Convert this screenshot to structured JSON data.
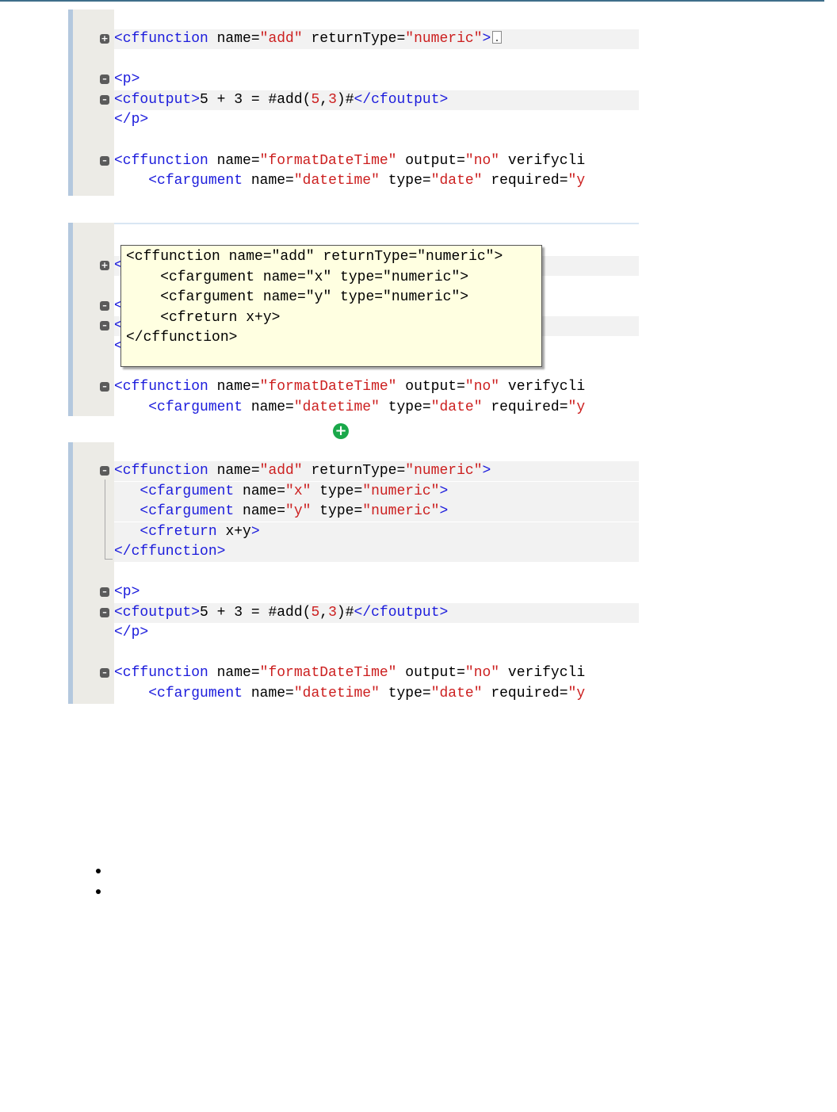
{
  "panel1": {
    "lines": [
      {
        "fold": "+",
        "parts": [
          [
            "t",
            "<cffunction "
          ],
          [
            "p",
            "name="
          ],
          [
            "s",
            "\"add\""
          ],
          [
            "p",
            " returnType="
          ],
          [
            "s",
            "\"numeric\""
          ],
          [
            "t",
            ">"
          ]
        ],
        "box": true
      },
      {
        "fold": "",
        "parts": []
      },
      {
        "fold": "-",
        "parts": [
          [
            "t",
            "<p>"
          ]
        ]
      },
      {
        "fold": "-",
        "parts": [
          [
            "t",
            "<cfoutput>"
          ],
          [
            "p",
            "5 + 3 = #add("
          ],
          [
            "n",
            "5"
          ],
          [
            "p",
            ","
          ],
          [
            "n",
            "3"
          ],
          [
            "p",
            ")#"
          ],
          [
            "t",
            "</cfoutput>"
          ]
        ]
      },
      {
        "fold": "",
        "parts": [
          [
            "t",
            "</p>"
          ]
        ]
      },
      {
        "fold": "",
        "parts": []
      },
      {
        "fold": "-",
        "parts": [
          [
            "t",
            "<cffunction "
          ],
          [
            "p",
            "name="
          ],
          [
            "s",
            "\"formatDateTime\""
          ],
          [
            "p",
            " output="
          ],
          [
            "s",
            "\"no\""
          ],
          [
            "p",
            " verifycli"
          ]
        ]
      },
      {
        "fold": "",
        "parts": [
          [
            "p",
            "    "
          ],
          [
            "t",
            "<cfargument "
          ],
          [
            "p",
            "name="
          ],
          [
            "s",
            "\"datetime\""
          ],
          [
            "p",
            " type="
          ],
          [
            "s",
            "\"date\""
          ],
          [
            "p",
            " required="
          ],
          [
            "s",
            "\"y"
          ]
        ]
      }
    ]
  },
  "panel2": {
    "lines": [
      {
        "fold": "",
        "parts": []
      },
      {
        "fold": "+",
        "parts": [
          [
            "t",
            "<"
          ]
        ]
      },
      {
        "fold": "",
        "parts": []
      },
      {
        "fold": "-",
        "parts": [
          [
            "t",
            "<"
          ]
        ]
      },
      {
        "fold": "-",
        "parts": [
          [
            "t",
            "<"
          ]
        ]
      },
      {
        "fold": "",
        "parts": [
          [
            "t",
            "<"
          ]
        ]
      },
      {
        "fold": "",
        "parts": []
      },
      {
        "fold": "-",
        "parts": [
          [
            "t",
            "<cffunction "
          ],
          [
            "p",
            "name="
          ],
          [
            "s",
            "\"formatDateTime\""
          ],
          [
            "p",
            " output="
          ],
          [
            "s",
            "\"no\""
          ],
          [
            "p",
            " verifycli"
          ]
        ]
      },
      {
        "fold": "",
        "parts": [
          [
            "p",
            "    "
          ],
          [
            "t",
            "<cfargument "
          ],
          [
            "p",
            "name="
          ],
          [
            "s",
            "\"datetime\""
          ],
          [
            "p",
            " type="
          ],
          [
            "s",
            "\"date\""
          ],
          [
            "p",
            " required="
          ],
          [
            "s",
            "\"y"
          ]
        ]
      }
    ],
    "tooltip": [
      "<cffunction name=\"add\" returnType=\"numeric\">",
      "    <cfargument name=\"x\" type=\"numeric\">",
      "    <cfargument name=\"y\" type=\"numeric\">",
      "    <cfreturn x+y>",
      "</cffunction>"
    ]
  },
  "panel3": {
    "lines": [
      {
        "fold": "-",
        "parts": [
          [
            "t",
            "<cffunction "
          ],
          [
            "p",
            "name="
          ],
          [
            "s",
            "\"add\""
          ],
          [
            "p",
            " returnType="
          ],
          [
            "s",
            "\"numeric\""
          ],
          [
            "t",
            ">"
          ]
        ]
      },
      {
        "fold": "",
        "parts": [
          [
            "p",
            "   "
          ],
          [
            "t",
            "<cfargument "
          ],
          [
            "p",
            "name="
          ],
          [
            "s",
            "\"x\""
          ],
          [
            "p",
            " type="
          ],
          [
            "s",
            "\"numeric\""
          ],
          [
            "t",
            ">"
          ]
        ]
      },
      {
        "fold": "",
        "parts": [
          [
            "p",
            "   "
          ],
          [
            "t",
            "<cfargument "
          ],
          [
            "p",
            "name="
          ],
          [
            "s",
            "\"y\""
          ],
          [
            "p",
            " type="
          ],
          [
            "s",
            "\"numeric\""
          ],
          [
            "t",
            ">"
          ]
        ]
      },
      {
        "fold": "",
        "parts": [
          [
            "p",
            "   "
          ],
          [
            "t",
            "<cfreturn "
          ],
          [
            "p",
            "x+y"
          ],
          [
            "t",
            ">"
          ]
        ]
      },
      {
        "fold": "",
        "parts": [
          [
            "t",
            "</cffunction>"
          ]
        ]
      },
      {
        "fold": "",
        "parts": []
      },
      {
        "fold": "-",
        "parts": [
          [
            "t",
            "<p>"
          ]
        ]
      },
      {
        "fold": "-",
        "parts": [
          [
            "t",
            "<cfoutput>"
          ],
          [
            "p",
            "5 + 3 = #add("
          ],
          [
            "n",
            "5"
          ],
          [
            "p",
            ","
          ],
          [
            "n",
            "3"
          ],
          [
            "p",
            ")#"
          ],
          [
            "t",
            "</cfoutput>"
          ]
        ]
      },
      {
        "fold": "",
        "parts": [
          [
            "t",
            "</p>"
          ]
        ]
      },
      {
        "fold": "",
        "parts": []
      },
      {
        "fold": "-",
        "parts": [
          [
            "t",
            "<cffunction "
          ],
          [
            "p",
            "name="
          ],
          [
            "s",
            "\"formatDateTime\""
          ],
          [
            "p",
            " output="
          ],
          [
            "s",
            "\"no\""
          ],
          [
            "p",
            " verifycli"
          ]
        ]
      },
      {
        "fold": "",
        "parts": [
          [
            "p",
            "    "
          ],
          [
            "t",
            "<cfargument "
          ],
          [
            "p",
            "name="
          ],
          [
            "s",
            "\"datetime\""
          ],
          [
            "p",
            " type="
          ],
          [
            "s",
            "\"date\""
          ],
          [
            "p",
            " required="
          ],
          [
            "s",
            "\"y"
          ]
        ]
      }
    ]
  },
  "icons": {
    "expand": "plus-icon",
    "fold_open": "minus-icon",
    "fold_closed": "plus-icon"
  },
  "colors": {
    "tag": "#1c1cdc",
    "string": "#cc1f1f",
    "tooltip_bg": "#ffffe1",
    "gutter": "#ecebe6",
    "expand_icon": "#1aa84a"
  }
}
